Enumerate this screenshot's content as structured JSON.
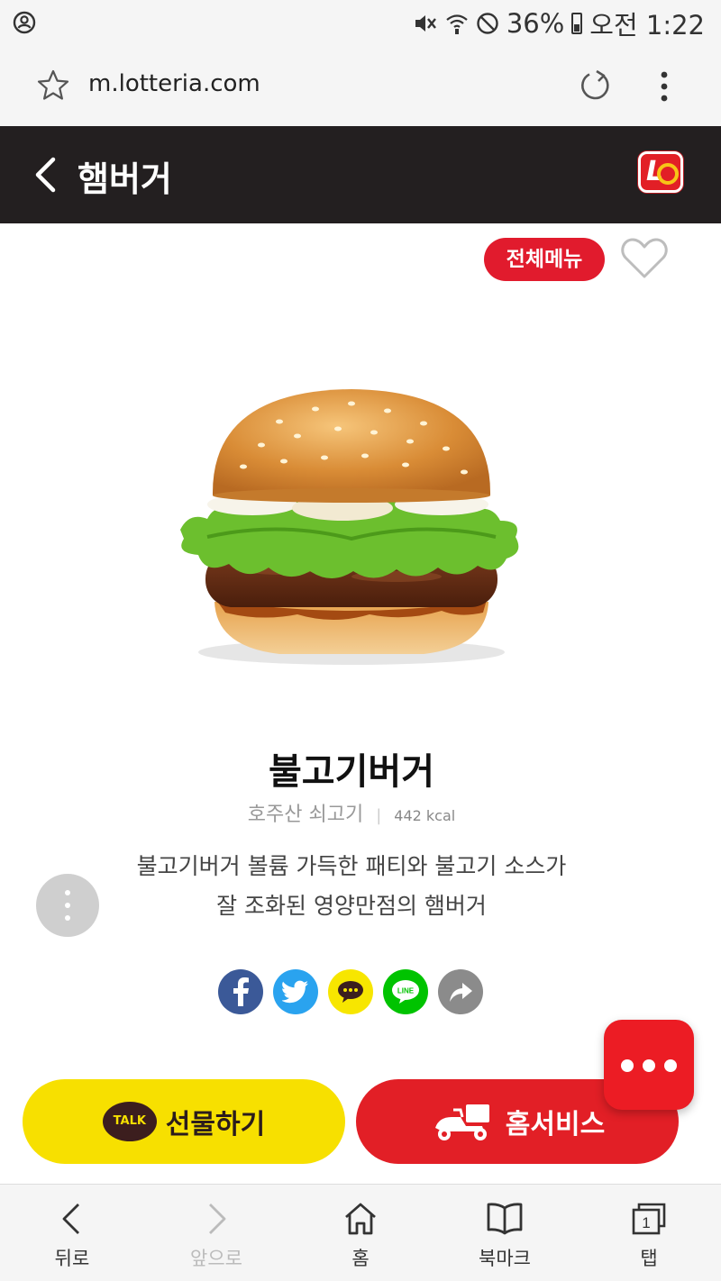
{
  "status_bar": {
    "battery": "36%",
    "time": "오전 1:22"
  },
  "url_bar": {
    "url": "m.lotteria.com"
  },
  "header": {
    "title": "햄버거",
    "brand_color": "#e21f26"
  },
  "actions": {
    "all_menu_label": "전체메뉴"
  },
  "product": {
    "name": "불고기버거",
    "origin": "호주산 쇠고기",
    "separator": "|",
    "kcal": "442 kcal",
    "description_line1": "불고기버거 볼륨 가득한 패티와 불고기 소스가",
    "description_line2": "잘 조화된 영양만점의 햄버거"
  },
  "share": {
    "icons": [
      "facebook-icon",
      "twitter-icon",
      "kakaostory-icon",
      "line-icon",
      "share-icon"
    ],
    "line_label": "LINE"
  },
  "buttons": {
    "gift_badge": "TALK",
    "gift_label": "선물하기",
    "home_service_label": "홈서비스"
  },
  "bottom_nav": {
    "back": "뒤로",
    "forward": "앞으로",
    "home": "홈",
    "bookmarks": "북마크",
    "tabs": "탭",
    "tab_count": "1"
  }
}
